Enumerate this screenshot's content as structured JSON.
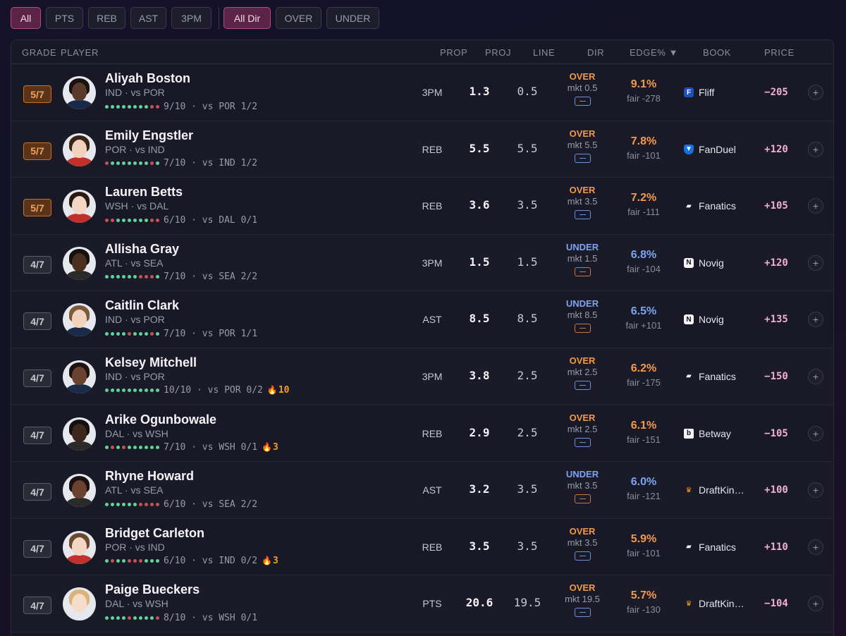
{
  "filters": {
    "props": [
      {
        "label": "All",
        "active": true
      },
      {
        "label": "PTS",
        "active": false
      },
      {
        "label": "REB",
        "active": false
      },
      {
        "label": "AST",
        "active": false
      },
      {
        "label": "3PM",
        "active": false
      }
    ],
    "directions": [
      {
        "label": "All Dir",
        "active": true
      },
      {
        "label": "OVER",
        "active": false
      },
      {
        "label": "UNDER",
        "active": false
      }
    ]
  },
  "columns": {
    "grade": "GRADE",
    "player": "PLAYER",
    "prop": "PROP",
    "proj": "PROJ",
    "line": "LINE",
    "dir": "DIR",
    "edge": "EDGE% ▼",
    "book": "BOOK",
    "price": "PRICE"
  },
  "colors": {
    "accent_pink": "#b04a86",
    "over": "#f09a48",
    "under": "#7ca4f0",
    "hit": "#5fd59a",
    "miss": "#c45252",
    "grade_high": "#c8702e"
  },
  "rows": [
    {
      "grade": "5/7",
      "name": "Aliyah Boston",
      "team": "IND · vs POR",
      "form": "ggggggggrr",
      "hist": "9/10  ·  vs POR 1/2",
      "streak": "",
      "prop": "3PM",
      "proj": "1.3",
      "line": "0.5",
      "dir": "OVER",
      "mkt": "mkt 0.5",
      "edge": "9.1%",
      "fair": "fair -278",
      "book": "Fliff",
      "book_icon": "fliff-icon",
      "price": "−205"
    },
    {
      "grade": "5/7",
      "name": "Emily Engstler",
      "team": "POR · vs IND",
      "form": "rgggggggrg",
      "hist": "7/10  ·  vs IND 1/2",
      "streak": "",
      "prop": "REB",
      "proj": "5.5",
      "line": "5.5",
      "dir": "OVER",
      "mkt": "mkt 5.5",
      "edge": "7.8%",
      "fair": "fair -101",
      "book": "FanDuel",
      "book_icon": "fanduel-shield-icon",
      "price": "+120"
    },
    {
      "grade": "5/7",
      "name": "Lauren Betts",
      "team": "WSH · vs DAL",
      "form": "rrggggggrr",
      "hist": "6/10  ·  vs DAL 0/1",
      "streak": "",
      "prop": "REB",
      "proj": "3.6",
      "line": "3.5",
      "dir": "OVER",
      "mkt": "mkt 3.5",
      "edge": "7.2%",
      "fair": "fair -111",
      "book": "Fanatics",
      "book_icon": "fanatics-icon",
      "price": "+105"
    },
    {
      "grade": "4/7",
      "name": "Allisha Gray",
      "team": "ATL · vs SEA",
      "form": "ggggggrrrg",
      "hist": "7/10  ·  vs SEA 2/2",
      "streak": "",
      "prop": "3PM",
      "proj": "1.5",
      "line": "1.5",
      "dir": "UNDER",
      "mkt": "mkt 1.5",
      "edge": "6.8%",
      "fair": "fair -104",
      "book": "Novig",
      "book_icon": "novig-icon",
      "price": "+120"
    },
    {
      "grade": "4/7",
      "name": "Caitlin Clark",
      "team": "IND · vs POR",
      "form": "ggggrgggrg",
      "hist": "7/10  ·  vs POR 1/1",
      "streak": "",
      "prop": "AST",
      "proj": "8.5",
      "line": "8.5",
      "dir": "UNDER",
      "mkt": "mkt 8.5",
      "edge": "6.5%",
      "fair": "fair +101",
      "book": "Novig",
      "book_icon": "novig-icon",
      "price": "+135"
    },
    {
      "grade": "4/7",
      "name": "Kelsey Mitchell",
      "team": "IND · vs POR",
      "form": "gggggggggg",
      "hist": "10/10  ·  vs POR 0/2",
      "streak": "10",
      "prop": "3PM",
      "proj": "3.8",
      "line": "2.5",
      "dir": "OVER",
      "mkt": "mkt 2.5",
      "edge": "6.2%",
      "fair": "fair -175",
      "book": "Fanatics",
      "book_icon": "fanatics-icon",
      "price": "−150"
    },
    {
      "grade": "4/7",
      "name": "Arike Ogunbowale",
      "team": "DAL · vs WSH",
      "form": "grgrgggggg",
      "hist": "7/10  ·  vs WSH 0/1",
      "streak": "3",
      "prop": "REB",
      "proj": "2.9",
      "line": "2.5",
      "dir": "OVER",
      "mkt": "mkt 2.5",
      "edge": "6.1%",
      "fair": "fair -151",
      "book": "Betway",
      "book_icon": "betway-icon",
      "price": "−105"
    },
    {
      "grade": "4/7",
      "name": "Rhyne Howard",
      "team": "ATL · vs SEA",
      "form": "ggggggrrrr",
      "hist": "6/10  ·  vs SEA 2/2",
      "streak": "",
      "prop": "AST",
      "proj": "3.2",
      "line": "3.5",
      "dir": "UNDER",
      "mkt": "mkt 3.5",
      "edge": "6.0%",
      "fair": "fair -121",
      "book": "DraftKin…",
      "book_icon": "draftkings-icon",
      "price": "+100"
    },
    {
      "grade": "4/7",
      "name": "Bridget Carleton",
      "team": "POR · vs IND",
      "form": "grggrrrggg",
      "hist": "6/10  ·  vs IND 0/2",
      "streak": "3",
      "prop": "REB",
      "proj": "3.5",
      "line": "3.5",
      "dir": "OVER",
      "mkt": "mkt 3.5",
      "edge": "5.9%",
      "fair": "fair -101",
      "book": "Fanatics",
      "book_icon": "fanatics-icon",
      "price": "+110"
    },
    {
      "grade": "4/7",
      "name": "Paige Bueckers",
      "team": "DAL · vs WSH",
      "form": "ggggrggggr",
      "hist": "8/10  ·  vs WSH 0/1",
      "streak": "",
      "prop": "PTS",
      "proj": "20.6",
      "line": "19.5",
      "dir": "OVER",
      "mkt": "mkt 19.5",
      "edge": "5.7%",
      "fair": "fair -130",
      "book": "DraftKin…",
      "book_icon": "draftkings-icon",
      "price": "−104"
    }
  ]
}
